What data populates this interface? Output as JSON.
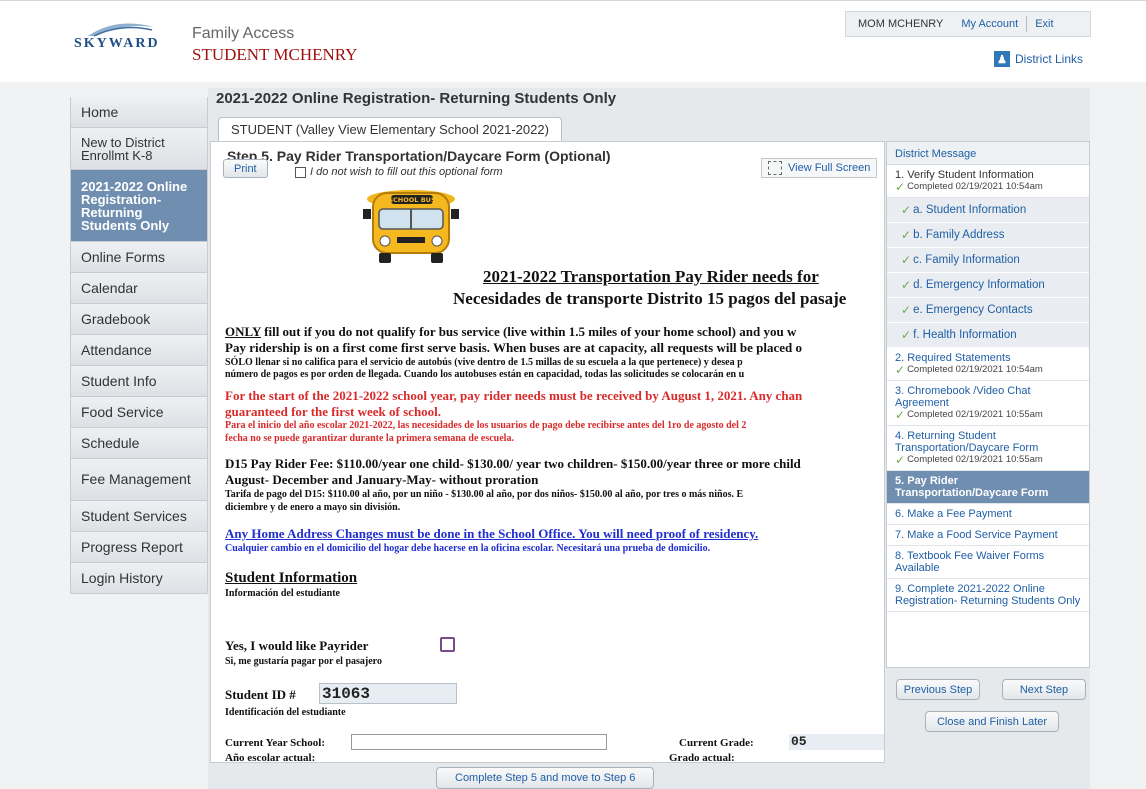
{
  "header": {
    "logo_text": "SKYWARD",
    "app_title": "Family Access",
    "student_name": "STUDENT MCHENRY",
    "user": "MOM MCHENRY",
    "my_account": "My Account",
    "exit": "Exit",
    "district_links": "District Links"
  },
  "nav": {
    "items": [
      "Home",
      "New to District Enrollmt K-8",
      "2021-2022 Online Registration- Returning Students Only",
      "Online Forms",
      "Calendar",
      "Gradebook",
      "Attendance",
      "Student Info",
      "Food Service",
      "Schedule",
      "Fee Management",
      "Student Services",
      "Progress Report",
      "Login History"
    ]
  },
  "main": {
    "heading": "2021-2022 Online Registration- Returning Students Only",
    "tab": "STUDENT (Valley View Elementary School 2021-2022)",
    "step_title": "Step 5. Pay Rider Transportation/Daycare Form (Optional)",
    "print": "Print",
    "optout": "I do not wish to fill out this optional form",
    "full_screen": "View Full Screen",
    "bus_sign": "SCHOOL BUS",
    "doc": {
      "title_en": "2021-2022 Transportation Pay Rider needs for",
      "title_es": "Necesidades de transporte Distrito 15 pagos del pasaje",
      "only": "ONLY",
      "p1a": " fill out  if you do not qualify for bus service (live within 1.5 miles of your home school) and you w",
      "p1b": "Pay ridership is on a first come first serve basis. When buses are at capacity, all requests will be placed o",
      "p1c": "SÓLO  llenar si no califica para el servicio de autobús (vive dentro de 1.5 millas de su escuela a la que pertenece) y desea p",
      "p1d": "número de pagos es por orden de llegada. Cuando los autobuses están en capacidad, todas las solicitudes se colocarán en u",
      "p2a": "For the start of the 2021-2022 school year, pay rider needs must be received by August 1, 2021. Any chan",
      "p2b": "guaranteed for the first week of school.",
      "p2c": "Para el inicio del año escolar 2021-2022, las necesidades de los usuarios de pago debe recibirse antes del 1ro de agosto del 2",
      "p2d": "fecha no se puede garantizar durante la primera semana de escuela.",
      "p3a": "D15 Pay Rider Fee: $110.00/year one child- $130.00/ year two children- $150.00/year three or more child",
      "p3b": "August- December and January-May- without proration",
      "p3c": "Tarifa de pago del D15: $110.00 al año, por un niño - $130.00 al año, por dos niños- $150.00 al año, por tres o más niños. E",
      "p3d": "diciembre y de enero a mayo  sin división.",
      "p4a": "Any Home Address Changes must be done in the School Office. You will need proof of residency.",
      "p4b": "Cualquier cambio en el domicilio del hogar debe hacerse en la oficina escolar. Necesitará una prueba de domicilio.",
      "student_info": "Student Information",
      "student_info_es": "Información del estudiante",
      "payrider": "Yes, I would like Payrider",
      "payrider_es": "Si, me gustaría pagar por el pasajero",
      "student_id_label": "Student ID #",
      "student_id": "31063",
      "student_id_es": "Identificación del estudiante",
      "school_label": "Current Year School:",
      "school_label_es": "Año escolar actual:",
      "grade_label": "Current Grade:",
      "grade_label_es": "Grado actual:",
      "grade": "05"
    },
    "complete_button": "Complete Step 5 and move to Step 6"
  },
  "steps": {
    "district_message": "District Message",
    "items": [
      {
        "label": "1. Verify Student Information",
        "done": "Completed 02/19/2021 10:54am"
      },
      {
        "label": "a. Student Information"
      },
      {
        "label": "b. Family Address"
      },
      {
        "label": "c. Family Information"
      },
      {
        "label": "d. Emergency Information"
      },
      {
        "label": "e. Emergency Contacts"
      },
      {
        "label": "f. Health Information"
      },
      {
        "label": "2. Required Statements",
        "done": "Completed 02/19/2021 10:54am"
      },
      {
        "label": "3. Chromebook /Video Chat Agreement",
        "done": "Completed 02/19/2021 10:55am"
      },
      {
        "label": "4. Returning Student Transportation/Daycare Form",
        "done": "Completed 02/19/2021 10:55am"
      },
      {
        "label": "5. Pay Rider Transportation/Daycare Form"
      },
      {
        "label": "6. Make a Fee Payment"
      },
      {
        "label": "7. Make a Food Service Payment"
      },
      {
        "label": "8. Textbook Fee Waiver Forms Available"
      },
      {
        "label": "9. Complete 2021-2022 Online Registration- Returning Students Only"
      }
    ],
    "previous": "Previous Step",
    "next": "Next Step",
    "close": "Close and Finish Later"
  }
}
